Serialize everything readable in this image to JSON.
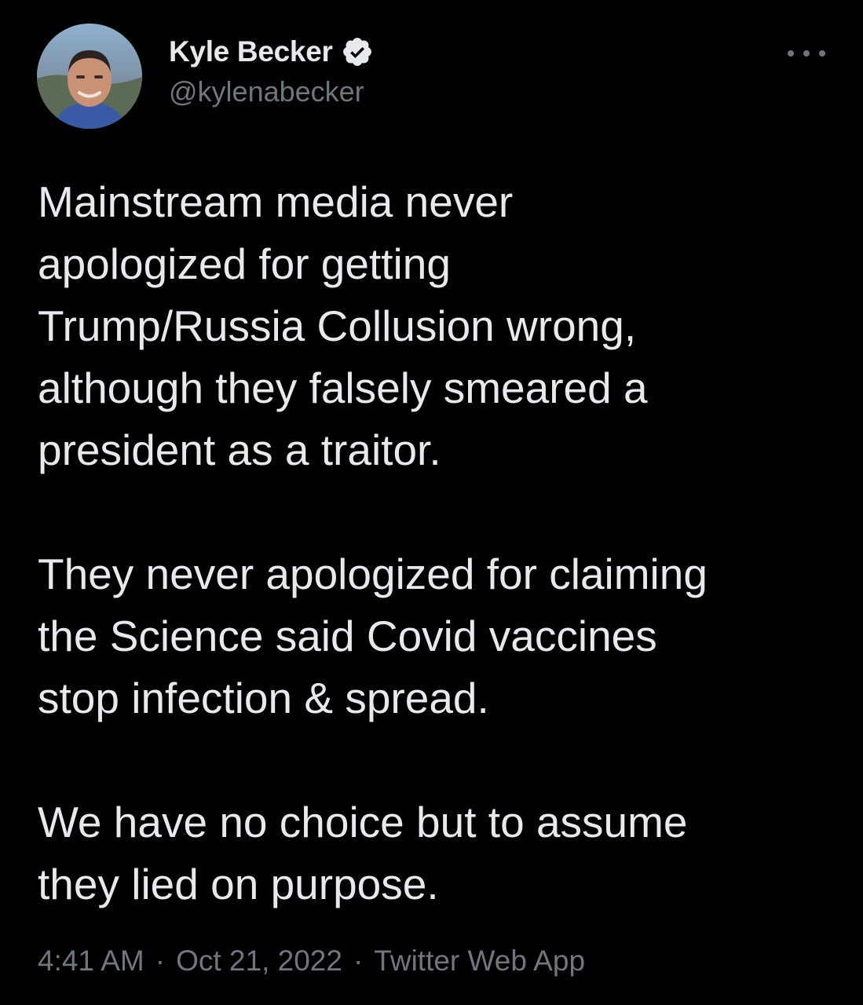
{
  "author": {
    "display_name": "Kyle Becker",
    "handle": "@kylenabecker",
    "verified": true,
    "avatar_icon": "profile-photo"
  },
  "tweet": {
    "paragraphs": [
      "Mainstream media never\napologized for getting\nTrump/Russia Collusion wrong,\nalthough they falsely smeared a\npresident as a traitor.",
      "They never apologized for claiming\nthe Science said Covid vaccines\nstop infection & spread.",
      "We have no choice but to assume\nthey lied on purpose."
    ],
    "time": "4:41 AM",
    "date": "Oct 21, 2022",
    "source": "Twitter Web App",
    "separator": "·"
  },
  "icons": {
    "more": "more-options-icon",
    "verified": "verified-badge-icon"
  },
  "colors": {
    "background": "#000000",
    "text": "#e7e9ea",
    "secondary": "#71767b"
  }
}
